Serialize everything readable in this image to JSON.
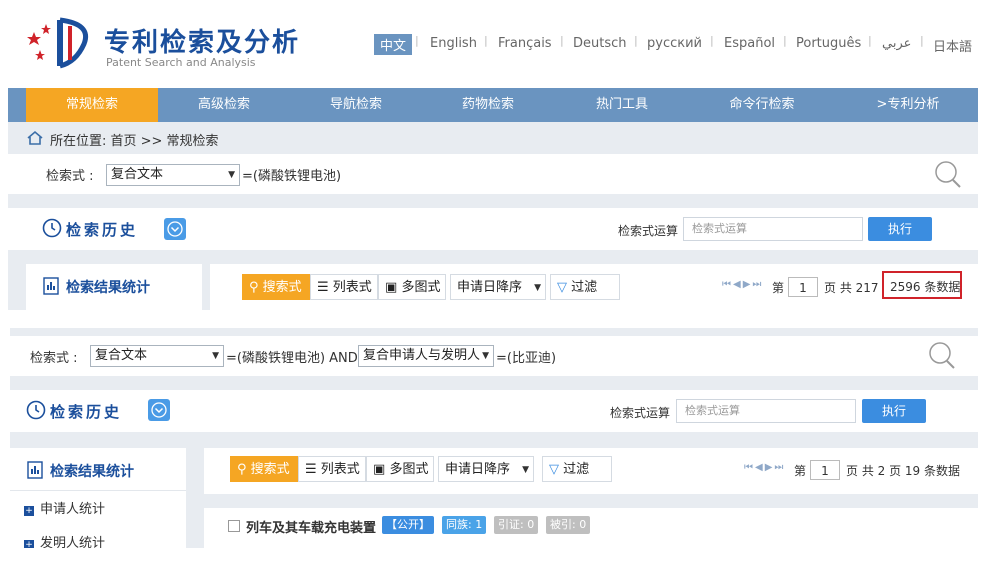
{
  "header": {
    "title_cn": "专利检索及分析",
    "title_en": "Patent Search and Analysis",
    "languages": [
      "中文",
      "English",
      "Français",
      "Deutsch",
      "русский",
      "Español",
      "Português",
      "عربي",
      "日本語"
    ]
  },
  "nav": {
    "items": [
      "常规检索",
      "高级检索",
      "导航检索",
      "药物检索",
      "热门工具",
      "命令行检索",
      ">专利分析"
    ]
  },
  "breadcrumb": "所在位置: 首页 >> 常规检索",
  "screen1": {
    "expr_label": "检索式 :",
    "expr_select": "复合文本",
    "expr_text": "=(磷酸铁锂电池)",
    "history_title": "检索历史",
    "expr_op_label": "检索式运算",
    "expr_op_placeholder": "检索式运算",
    "exec_button": "执行",
    "stats_title": "检索结果统计",
    "toolbar": {
      "search_mode": "搜索式",
      "list_mode": "列表式",
      "image_mode": "多图式",
      "sort": "申请日降序",
      "filter": "过滤"
    },
    "pager": {
      "page_prefix": "第",
      "page_value": "1",
      "pages_text": "页 共 217 页",
      "count_text": "2596 条数据"
    }
  },
  "screen2": {
    "expr_label": "检索式 :",
    "expr_select": "复合文本",
    "expr_text_1": "=(磷酸铁锂电池) AND",
    "expr_select_2": "复合申请人与发明人",
    "expr_text_2": "=(比亚迪)",
    "history_title": "检索历史",
    "expr_op_label": "检索式运算",
    "expr_op_placeholder": "检索式运算",
    "exec_button": "执行",
    "stats_title": "检索结果统计",
    "stats_items": [
      "申请人统计",
      "发明人统计"
    ],
    "toolbar": {
      "search_mode": "搜索式",
      "list_mode": "列表式",
      "image_mode": "多图式",
      "sort": "申请日降序",
      "filter": "过滤"
    },
    "pager": {
      "page_prefix": "第",
      "page_value": "1",
      "pages_text": "页 共 2 页 19 条数据"
    },
    "result": {
      "title": "列车及其车载充电装置",
      "status": "【公开】",
      "family": "同族: 1",
      "cited": "引证: 0",
      "cited_by": "被引: 0"
    }
  },
  "colors": {
    "nav_bg": "#6a94c0",
    "nav_active": "#f5a623",
    "brand_blue": "#1b4f9c",
    "highlight_red": "#d0232a",
    "exec_blue": "#3b8de0"
  }
}
